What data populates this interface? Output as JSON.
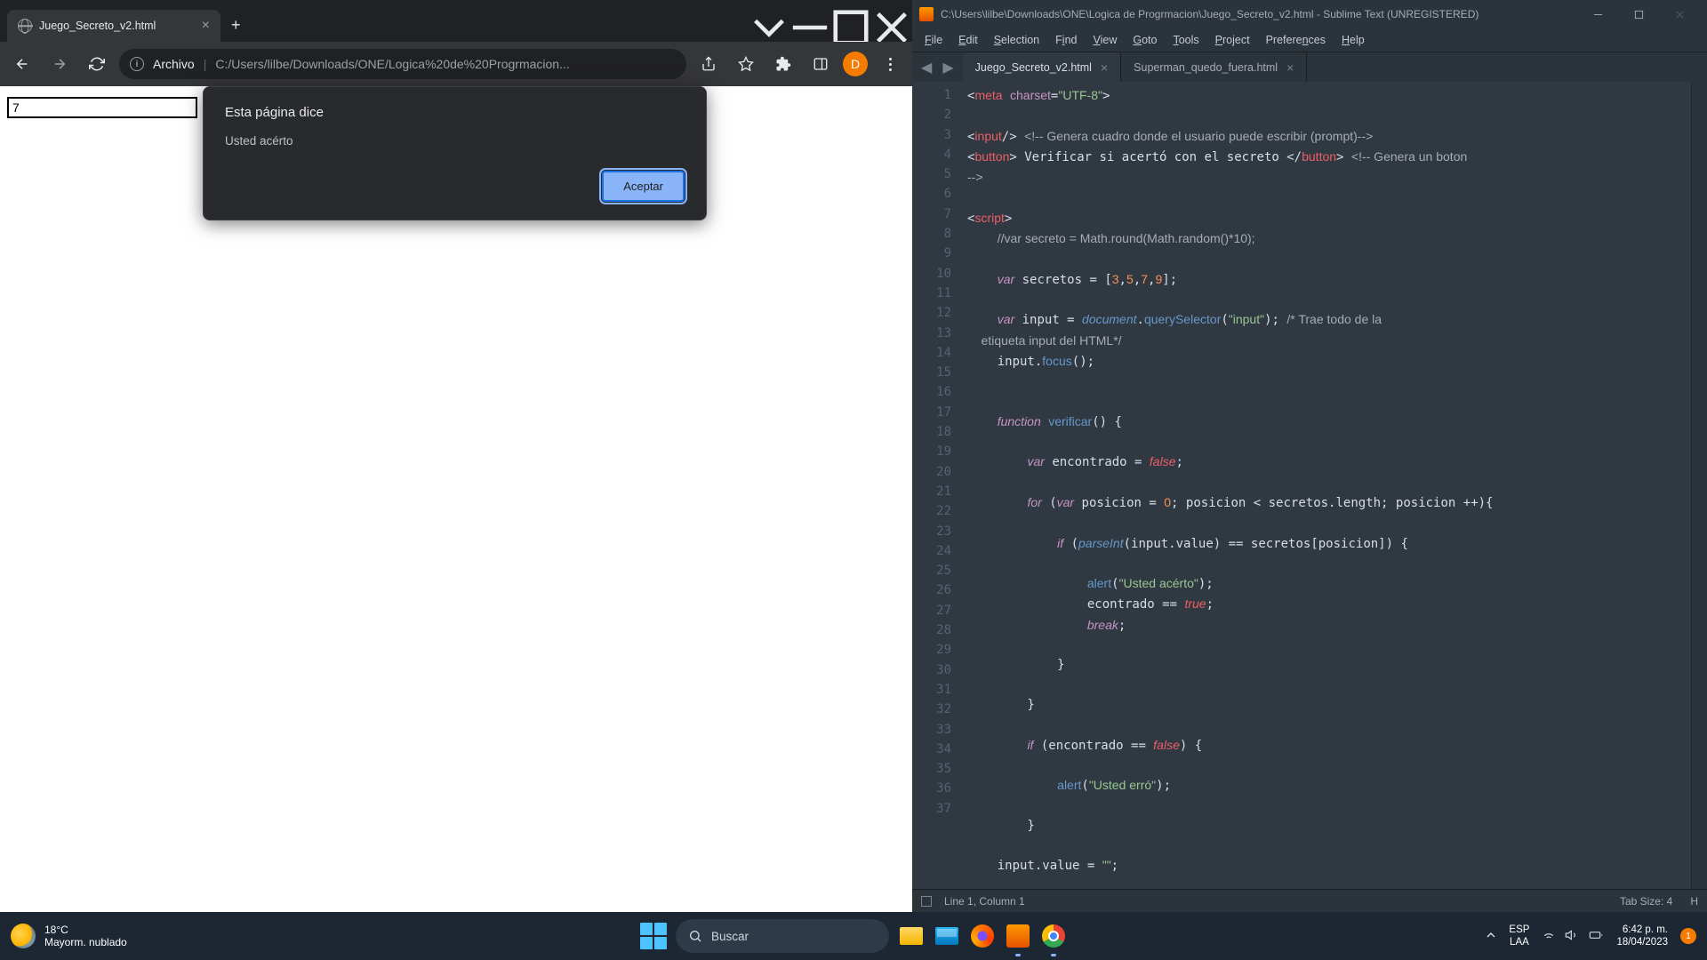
{
  "chrome": {
    "tab_title": "Juego_Secreto_v2.html",
    "addr_label": "Archivo",
    "url": "C:/Users/lilbe/Downloads/ONE/Logica%20de%20Progrmacion...",
    "profile_letter": "D",
    "page_input_value": "7",
    "alert": {
      "title": "Esta página dice",
      "message": "Usted acérto",
      "ok": "Aceptar"
    }
  },
  "sublime": {
    "title": "C:\\Users\\lilbe\\Downloads\\ONE\\Logica de Progrmacion\\Juego_Secreto_v2.html - Sublime Text (UNREGISTERED)",
    "menu": [
      "File",
      "Edit",
      "Selection",
      "Find",
      "View",
      "Goto",
      "Tools",
      "Project",
      "Preferences",
      "Help"
    ],
    "tabs": [
      {
        "label": "Juego_Secreto_v2.html",
        "active": true
      },
      {
        "label": "Superman_quedo_fuera.html",
        "active": false
      }
    ],
    "status_left": "Line 1, Column 1",
    "status_tab": "Tab Size: 4",
    "status_lang": "H",
    "line_count": 37
  },
  "taskbar": {
    "temp": "18°C",
    "weather": "Mayorm. nublado",
    "search": "Buscar",
    "lang1": "ESP",
    "lang2": "LAA",
    "time": "6:42 p. m.",
    "date": "18/04/2023",
    "notif": "1"
  }
}
